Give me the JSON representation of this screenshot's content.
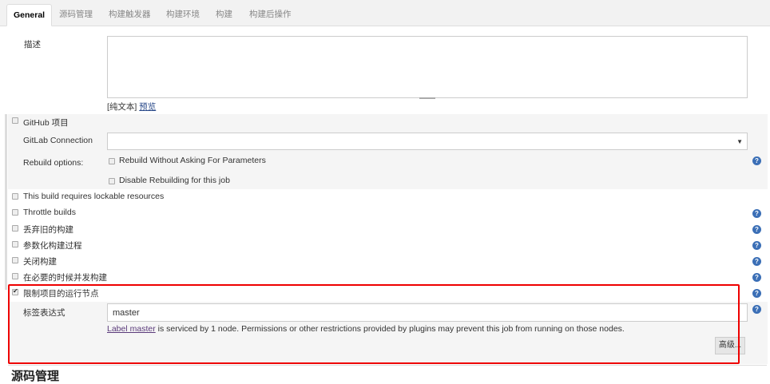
{
  "tabs": [
    "General",
    "源码管理",
    "构建触发器",
    "构建环境",
    "构建",
    "构建后操作"
  ],
  "description": {
    "label": "描述",
    "value": "",
    "plain_text": "[纯文本]",
    "preview": "预览"
  },
  "github": {
    "label": "GitHub 项目",
    "checked": false
  },
  "gitlab": {
    "label": "GitLab Connection",
    "value": ""
  },
  "rebuild": {
    "label": "Rebuild options:",
    "opt1": "Rebuild Without Asking For Parameters",
    "opt2": "Disable Rebuilding for this job"
  },
  "options": [
    {
      "label": "This build requires lockable resources",
      "checked": false
    },
    {
      "label": "Throttle builds",
      "checked": false
    },
    {
      "label": "丢弃旧的构建",
      "checked": false
    },
    {
      "label": "参数化构建过程",
      "checked": false
    },
    {
      "label": "关闭构建",
      "checked": false
    },
    {
      "label": "在必要的时候并发构建",
      "checked": false
    }
  ],
  "restrict": {
    "label": "限制项目的运行节点",
    "checked": true,
    "expr_label": "标签表达式",
    "expr_value": "master",
    "link": "Label master",
    "message": " is serviced by 1 node. Permissions or other restrictions provided by plugins may prevent this job from running on those nodes.",
    "advanced": "高级..."
  },
  "next_section": "源码管理",
  "help_icon": "?"
}
